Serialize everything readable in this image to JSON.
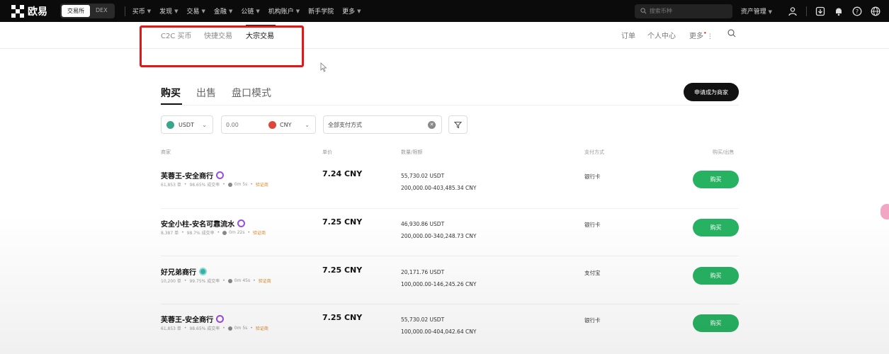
{
  "topbar": {
    "brand": "欧易",
    "modes": [
      "交易所",
      "DEX"
    ],
    "nav": [
      "买币",
      "发现",
      "交易",
      "金融",
      "公链",
      "机构账户",
      "新手学院",
      "更多"
    ],
    "search_placeholder": "搜索币种",
    "asset_menu": "资产管理"
  },
  "subnav": {
    "tabs": [
      "C2C 买币",
      "快捷交易",
      "大宗交易"
    ],
    "right": {
      "orders": "订单",
      "profile": "个人中心",
      "more": "更多"
    }
  },
  "trade": {
    "tabs": [
      "购买",
      "出售",
      "盘口模式"
    ],
    "merchant_button": "申请成为商家"
  },
  "filters": {
    "coin": "USDT",
    "amount_placeholder": "0.00",
    "fiat": "CNY",
    "payment": "全部支付方式"
  },
  "table": {
    "headers": {
      "merchant": "商家",
      "price": "单价",
      "limit": "数量/限额",
      "payment": "支付方式",
      "action": "购买/出售"
    },
    "rows": [
      {
        "name": "芙蓉王-安全商行",
        "orders": "61,853 单",
        "completion": "98.65% 成交率",
        "time": "0m 5s",
        "deposit": "验证商",
        "price": "7.24 CNY",
        "available": "55,730.02 USDT",
        "limit": "200,000.00-403,485.34 CNY",
        "payment": "银行卡",
        "action": "购买"
      },
      {
        "name": "安全小柱-安名可靠流水",
        "orders": "8,387 单",
        "completion": "98.7% 成交率",
        "time": "0m 22s",
        "deposit": "验证商",
        "price": "7.25 CNY",
        "available": "46,930.86 USDT",
        "limit": "200,000.00-340,248.73 CNY",
        "payment": "银行卡",
        "action": "购买"
      },
      {
        "name": "好兄弟商行",
        "orders": "10,200 单",
        "completion": "99.75% 成交率",
        "time": "0m 45s",
        "deposit": "验证商",
        "price": "7.25 CNY",
        "available": "20,171.76 USDT",
        "limit": "100,000.00-146,245.26 CNY",
        "payment": "支付宝",
        "action": "购买"
      },
      {
        "name": "芙蓉王-安全商行",
        "orders": "61,853 单",
        "completion": "98.65% 成交率",
        "time": "0m 5s",
        "deposit": "验证商",
        "price": "7.25 CNY",
        "available": "55,730.02 USDT",
        "limit": "100,000.00-404,042.64 CNY",
        "payment": "银行卡",
        "action": "购买"
      }
    ]
  },
  "colors": {
    "accent_buy": "#27b262",
    "highlight_box": "#e01818",
    "topbar_bg": "#0b0b0b"
  }
}
